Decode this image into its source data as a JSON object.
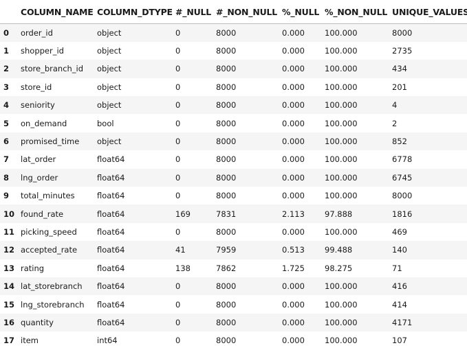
{
  "table": {
    "columns": [
      "",
      "COLUMN_NAME",
      "COLUMN_DTYPE",
      "#_NULL",
      "#_NON_NULL",
      "%_NULL",
      "%_NON_NULL",
      "UNIQUE_VALUES"
    ],
    "rows": [
      [
        "0",
        "order_id",
        "object",
        "0",
        "8000",
        "0.000",
        "100.000",
        "8000"
      ],
      [
        "1",
        "shopper_id",
        "object",
        "0",
        "8000",
        "0.000",
        "100.000",
        "2735"
      ],
      [
        "2",
        "store_branch_id",
        "object",
        "0",
        "8000",
        "0.000",
        "100.000",
        "434"
      ],
      [
        "3",
        "store_id",
        "object",
        "0",
        "8000",
        "0.000",
        "100.000",
        "201"
      ],
      [
        "4",
        "seniority",
        "object",
        "0",
        "8000",
        "0.000",
        "100.000",
        "4"
      ],
      [
        "5",
        "on_demand",
        "bool",
        "0",
        "8000",
        "0.000",
        "100.000",
        "2"
      ],
      [
        "6",
        "promised_time",
        "object",
        "0",
        "8000",
        "0.000",
        "100.000",
        "852"
      ],
      [
        "7",
        "lat_order",
        "float64",
        "0",
        "8000",
        "0.000",
        "100.000",
        "6778"
      ],
      [
        "8",
        "lng_order",
        "float64",
        "0",
        "8000",
        "0.000",
        "100.000",
        "6745"
      ],
      [
        "9",
        "total_minutes",
        "float64",
        "0",
        "8000",
        "0.000",
        "100.000",
        "8000"
      ],
      [
        "10",
        "found_rate",
        "float64",
        "169",
        "7831",
        "2.113",
        "97.888",
        "1816"
      ],
      [
        "11",
        "picking_speed",
        "float64",
        "0",
        "8000",
        "0.000",
        "100.000",
        "469"
      ],
      [
        "12",
        "accepted_rate",
        "float64",
        "41",
        "7959",
        "0.513",
        "99.488",
        "140"
      ],
      [
        "13",
        "rating",
        "float64",
        "138",
        "7862",
        "1.725",
        "98.275",
        "71"
      ],
      [
        "14",
        "lat_storebranch",
        "float64",
        "0",
        "8000",
        "0.000",
        "100.000",
        "416"
      ],
      [
        "15",
        "lng_storebranch",
        "float64",
        "0",
        "8000",
        "0.000",
        "100.000",
        "414"
      ],
      [
        "16",
        "quantity",
        "float64",
        "0",
        "8000",
        "0.000",
        "100.000",
        "4171"
      ],
      [
        "17",
        "item",
        "int64",
        "0",
        "8000",
        "0.000",
        "100.000",
        "107"
      ]
    ]
  }
}
